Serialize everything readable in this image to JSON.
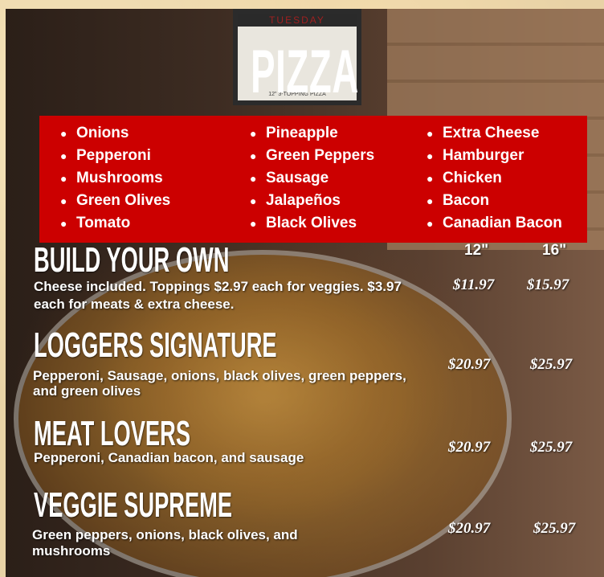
{
  "title": "PIZZA",
  "sign": {
    "day": "TUESDAY",
    "footer": "12\" 3-TOPPING PIZZA"
  },
  "toppings": {
    "column1": [
      "Onions",
      "Pepperoni",
      "Mushrooms",
      "Green Olives",
      "Tomato"
    ],
    "column2": [
      "Pineapple",
      "Green Peppers",
      "Sausage",
      "Jalapeños",
      "Black Olives"
    ],
    "column3": [
      "Extra Cheese",
      "Hamburger",
      "Chicken",
      "Bacon",
      "Canadian Bacon"
    ],
    "background_color": "#cc0000"
  },
  "sizes": {
    "small": "12\"",
    "large": "16\""
  },
  "items": [
    {
      "name": "BUILD YOUR OWN",
      "description": "Cheese included. Toppings $2.97 each for veggies. $3.97 each for meats & extra cheese.",
      "price_12": "$11.97",
      "price_16": "$15.97"
    },
    {
      "name": "LOGGERS SIGNATURE",
      "description": "Pepperoni, Sausage, onions, black olives, green peppers, and green olives",
      "price_12": "$20.97",
      "price_16": "$25.97"
    },
    {
      "name": "MEAT LOVERS",
      "description": "Pepperoni, Canadian bacon, and sausage",
      "price_12": "$20.97",
      "price_16": "$25.97"
    },
    {
      "name": "VEGGIE SUPREME",
      "description": "Green peppers, onions, black olives, and mushrooms",
      "price_12": "$20.97",
      "price_16": "$25.97"
    }
  ]
}
